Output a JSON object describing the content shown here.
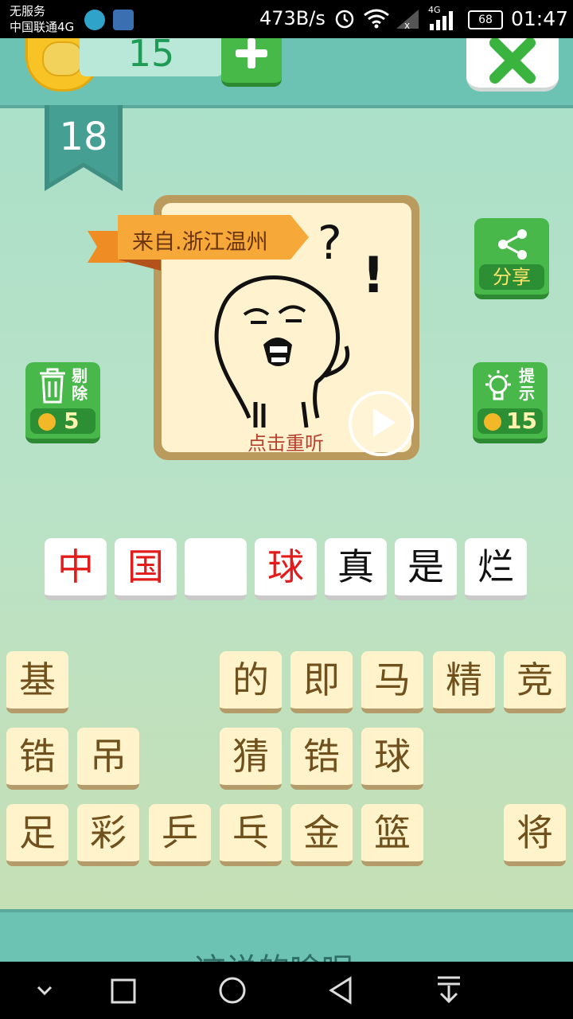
{
  "status_bar": {
    "carrier_line1": "无服务",
    "carrier_line2": "中国联通4G",
    "network_speed": "473B/s",
    "signal_type": "4G",
    "battery": "68",
    "time": "01:47"
  },
  "header": {
    "coins": "15"
  },
  "level": {
    "number": "18"
  },
  "question": {
    "source": "来自.浙江温州",
    "replay_label": "点击重听"
  },
  "side_buttons": {
    "remove": {
      "label_line1": "剔",
      "label_line2": "除",
      "cost": "5"
    },
    "share": {
      "label": "分享"
    },
    "hint": {
      "label_line1": "提",
      "label_line2": "示",
      "cost": "15"
    }
  },
  "answer": {
    "slots": [
      "中",
      "国",
      "",
      "球",
      "真",
      "是",
      "烂"
    ]
  },
  "candidates": {
    "row1": [
      "基",
      "",
      "",
      "的",
      "即",
      "马",
      "精",
      "竞"
    ],
    "row2": [
      "锆",
      "吊",
      "",
      "猜",
      "锆",
      "球",
      "",
      ""
    ],
    "row3": [
      "足",
      "彩",
      "乒",
      "乓",
      "金",
      "篮",
      "",
      "将"
    ]
  },
  "bottom": {
    "text": "这说的啥呢"
  },
  "colors": {
    "accent_green": "#46b949",
    "header_teal": "#6cc3b3",
    "answer_red": "#e21b1b",
    "tile_bg": "#fff3cb"
  }
}
